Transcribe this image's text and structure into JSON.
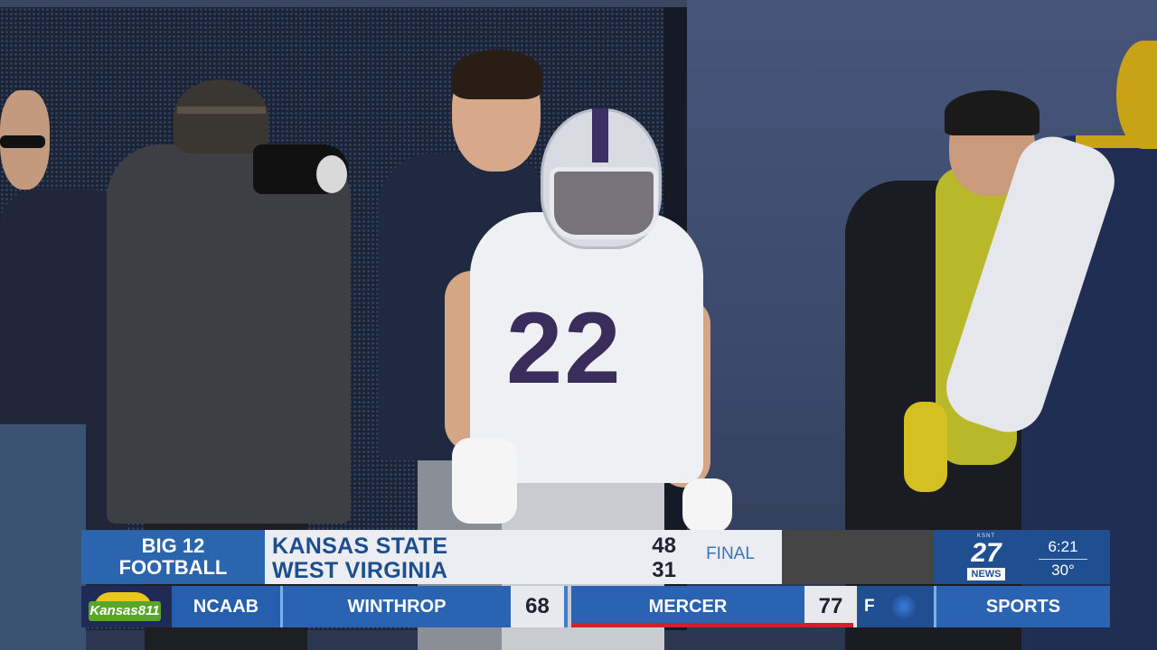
{
  "scoreboard": {
    "label_line1": "BIG 12",
    "label_line2": "FOOTBALL",
    "team1": "KANSAS STATE",
    "team2": "WEST VIRGINIA",
    "score1": "48",
    "score2": "31",
    "status": "FINAL"
  },
  "station": {
    "logo_top": "KSNT",
    "logo_number": "27",
    "logo_word": "NEWS",
    "time": "6:21",
    "temperature": "30°"
  },
  "ticker": {
    "sponsor": "Kansas811",
    "league": "NCAAB",
    "team1": "WINTHROP",
    "score1": "68",
    "team2": "MERCER",
    "score2": "77",
    "status": "F",
    "section": "SPORTS"
  },
  "scene": {
    "jersey_number": "22"
  },
  "colors": {
    "primary_blue": "#2a63b1",
    "dark_blue": "#1f4e91",
    "team_text_blue": "#1d4f8e",
    "accent_red": "#d21f2a"
  }
}
